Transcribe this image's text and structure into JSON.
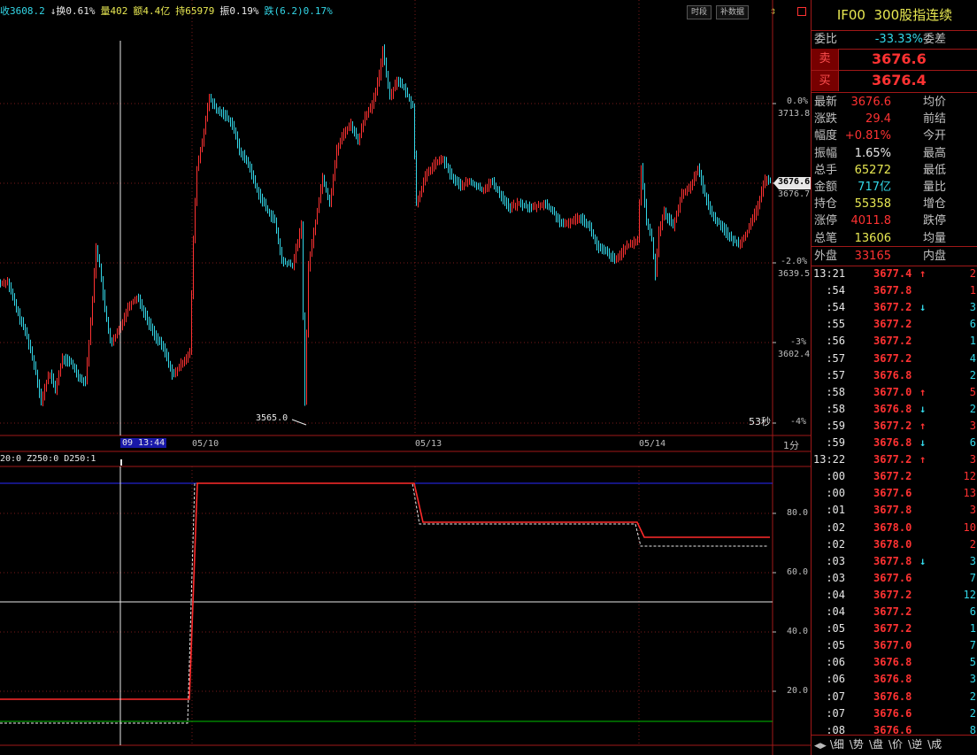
{
  "colors": {
    "up": "#ff3232",
    "down": "#33d7e8",
    "label": "#c0c0c0",
    "yellow": "#e8e852",
    "white": "#e8e8e8",
    "green": "#00c000"
  },
  "top_info": [
    {
      "text": "收3608.2",
      "color": "#33d7e8"
    },
    {
      "text": "↓换0.61%",
      "color": "#e8e8e8"
    },
    {
      "text": "量402",
      "color": "#e8e852"
    },
    {
      "text": "额4.4亿",
      "color": "#e8e852"
    },
    {
      "text": "持65979",
      "color": "#e8e852"
    },
    {
      "text": "振0.19%",
      "color": "#e8e8e8"
    },
    {
      "text": "跌(6.2)0.17%",
      "color": "#33d7e8"
    }
  ],
  "toolbar": {
    "btn_time": "时段",
    "btn_fill": "补数据",
    "icon_arrows": "up-down-arrow-icon",
    "icon_box": "window-box-icon"
  },
  "main_chart": {
    "pct_labels": [
      {
        "text": "0.0%",
        "sub": "3713.8"
      },
      {
        "text": "-2.0%",
        "sub": "3639.5"
      },
      {
        "text": "-3%",
        "sub": "3602.4"
      },
      {
        "text": "-4%",
        "sub": ""
      }
    ],
    "current_price_tag": "3676.6",
    "current_price_sub": "3676.7",
    "low_marker": "3565.0",
    "countdown": "53秒"
  },
  "time_axis": {
    "cursor_label": "09 13:44",
    "dates": [
      "05/10",
      "05/13",
      "05/14"
    ],
    "period": "1分"
  },
  "indicator": {
    "legend": "20:0 Z250:0 D250:1",
    "scale": [
      "80.0",
      "60.0",
      "40.0",
      "20.0"
    ]
  },
  "quote": {
    "code": "IF00",
    "name": "300股指连续",
    "weibi_label": "委比",
    "weibi_value": "-33.33%",
    "weicha_label": "委差",
    "sell_label": "卖",
    "sell_price": "3676.6",
    "buy_label": "买",
    "buy_price": "3676.4",
    "rows": [
      {
        "label": "最新",
        "value": "3676.6",
        "color": "#ff3232",
        "label2": "均价"
      },
      {
        "label": "涨跌",
        "value": "29.4",
        "color": "#ff3232",
        "label2": "前结"
      },
      {
        "label": "幅度",
        "value": "+0.81%",
        "color": "#ff3232",
        "label2": "今开"
      },
      {
        "label": "振幅",
        "value": "1.65%",
        "color": "#e8e8e8",
        "label2": "最高"
      },
      {
        "label": "总手",
        "value": "65272",
        "color": "#e8e852",
        "label2": "最低"
      },
      {
        "label": "金额",
        "value": "717亿",
        "color": "#33d7e8",
        "label2": "量比"
      },
      {
        "label": "持仓",
        "value": "55358",
        "color": "#e8e852",
        "label2": "增仓"
      },
      {
        "label": "涨停",
        "value": "4011.8",
        "color": "#ff3232",
        "label2": "跌停"
      },
      {
        "label": "总笔",
        "value": "13606",
        "color": "#e8e852",
        "label2": "均量"
      }
    ],
    "outer_label": "外盘",
    "outer_value": "33165",
    "inner_label": "内盘"
  },
  "ticks": [
    {
      "time": "13:21",
      "price": "3677.4",
      "dir": "up",
      "vol": "2",
      "vc": "#ff3232"
    },
    {
      "time": ":54",
      "price": "3677.8",
      "dir": "",
      "vol": "1",
      "vc": "#ff3232"
    },
    {
      "time": ":54",
      "price": "3677.2",
      "dir": "down",
      "vol": "3",
      "vc": "#33d7e8"
    },
    {
      "time": ":55",
      "price": "3677.2",
      "dir": "",
      "vol": "6",
      "vc": "#33d7e8"
    },
    {
      "time": ":56",
      "price": "3677.2",
      "dir": "",
      "vol": "1",
      "vc": "#33d7e8"
    },
    {
      "time": ":57",
      "price": "3677.2",
      "dir": "",
      "vol": "4",
      "vc": "#33d7e8"
    },
    {
      "time": ":57",
      "price": "3676.8",
      "dir": "",
      "vol": "2",
      "vc": "#33d7e8"
    },
    {
      "time": ":58",
      "price": "3677.0",
      "dir": "up",
      "vol": "5",
      "vc": "#ff3232"
    },
    {
      "time": ":58",
      "price": "3676.8",
      "dir": "down",
      "vol": "2",
      "vc": "#33d7e8"
    },
    {
      "time": ":59",
      "price": "3677.2",
      "dir": "up",
      "vol": "3",
      "vc": "#ff3232"
    },
    {
      "time": ":59",
      "price": "3676.8",
      "dir": "down",
      "vol": "6",
      "vc": "#33d7e8"
    },
    {
      "time": "13:22",
      "price": "3677.2",
      "dir": "up",
      "vol": "3",
      "vc": "#ff3232"
    },
    {
      "time": ":00",
      "price": "3677.2",
      "dir": "",
      "vol": "12",
      "vc": "#ff3232"
    },
    {
      "time": ":00",
      "price": "3677.6",
      "dir": "",
      "vol": "13",
      "vc": "#ff3232"
    },
    {
      "time": ":01",
      "price": "3677.8",
      "dir": "",
      "vol": "3",
      "vc": "#ff3232"
    },
    {
      "time": ":02",
      "price": "3678.0",
      "dir": "",
      "vol": "10",
      "vc": "#ff3232"
    },
    {
      "time": ":02",
      "price": "3678.0",
      "dir": "",
      "vol": "2",
      "vc": "#ff3232"
    },
    {
      "time": ":03",
      "price": "3677.8",
      "dir": "down",
      "vol": "3",
      "vc": "#33d7e8"
    },
    {
      "time": ":03",
      "price": "3677.6",
      "dir": "",
      "vol": "7",
      "vc": "#33d7e8"
    },
    {
      "time": ":04",
      "price": "3677.2",
      "dir": "",
      "vol": "12",
      "vc": "#33d7e8"
    },
    {
      "time": ":04",
      "price": "3677.2",
      "dir": "",
      "vol": "6",
      "vc": "#33d7e8"
    },
    {
      "time": ":05",
      "price": "3677.2",
      "dir": "",
      "vol": "1",
      "vc": "#33d7e8"
    },
    {
      "time": ":05",
      "price": "3677.0",
      "dir": "",
      "vol": "7",
      "vc": "#33d7e8"
    },
    {
      "time": ":06",
      "price": "3676.8",
      "dir": "",
      "vol": "5",
      "vc": "#33d7e8"
    },
    {
      "time": ":06",
      "price": "3676.8",
      "dir": "",
      "vol": "3",
      "vc": "#33d7e8"
    },
    {
      "time": ":07",
      "price": "3676.8",
      "dir": "",
      "vol": "2",
      "vc": "#33d7e8"
    },
    {
      "time": ":07",
      "price": "3676.6",
      "dir": "",
      "vol": "2",
      "vc": "#33d7e8"
    },
    {
      "time": ":08",
      "price": "3676.6",
      "dir": "",
      "vol": "8",
      "vc": "#33d7e8"
    }
  ],
  "bottom_tabs": [
    "细",
    "势",
    "盘",
    "价",
    "逆",
    "成"
  ]
}
